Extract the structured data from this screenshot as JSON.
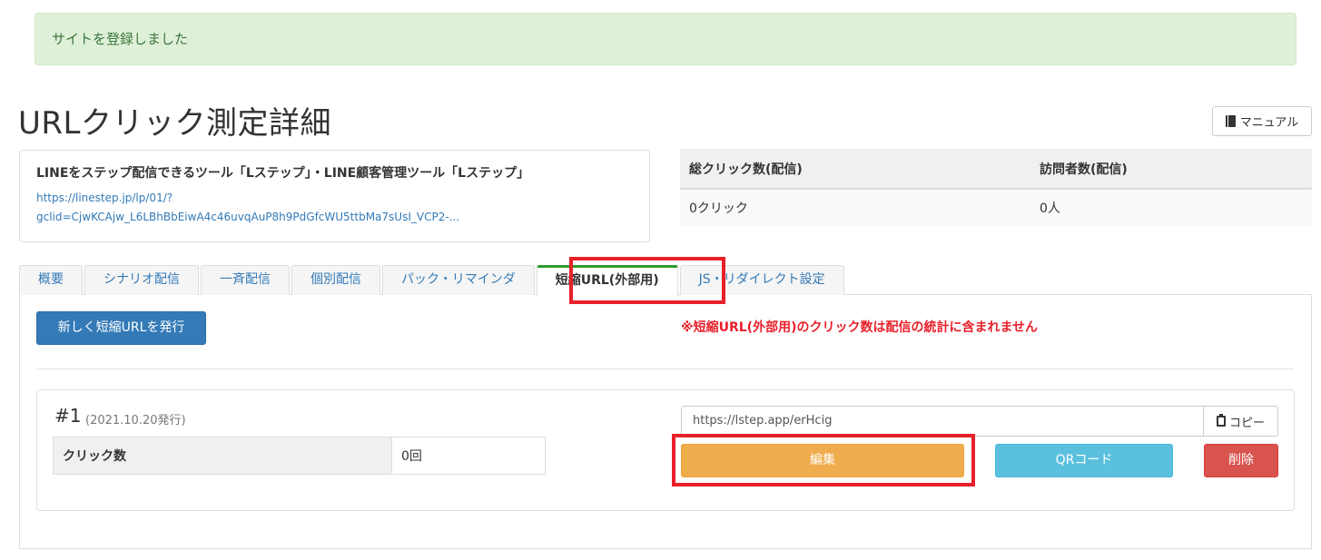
{
  "alert": {
    "message": "サイトを登録しました"
  },
  "header": {
    "title": "URLクリック測定詳細",
    "manual_label": "マニュアル"
  },
  "site": {
    "name": "LINEをステップ配信できるツール「Lステップ」・LINE顧客管理ツール「Lステップ」",
    "url_line1": "https://linestep.jp/lp/01/?",
    "url_line2": "gclid=CjwKCAjw_L6LBhBbEiwA4c46uvqAuP8h9PdGfcWU5ttbMa7sUsI_VCP2-..."
  },
  "stats": {
    "headers": [
      "総クリック数(配信)",
      "訪問者数(配信)"
    ],
    "values": [
      "0クリック",
      "0人"
    ]
  },
  "tabs": [
    {
      "label": "概要"
    },
    {
      "label": "シナリオ配信"
    },
    {
      "label": "一斉配信"
    },
    {
      "label": "個別配信"
    },
    {
      "label": "パック・リマインダ"
    },
    {
      "label": "短縮URL(外部用)"
    },
    {
      "label": "JS・リダイレクト設定"
    }
  ],
  "short_url": {
    "issue_label": "新しく短縮URLを発行",
    "warning": "※短縮URL(外部用)のクリック数は配信の統計に含まれません",
    "item": {
      "number": "#1",
      "date": "(2021.10.20発行)",
      "click_label": "クリック数",
      "click_value": "0回",
      "url": "https://lstep.app/erHcig",
      "copy_label": "コピー",
      "edit_label": "編集",
      "qr_label": "QRコード",
      "delete_label": "削除"
    }
  },
  "icons": {
    "manual": "book-icon",
    "copy": "clipboard-icon"
  },
  "colors": {
    "highlight": "#e8202a",
    "primary": "#337ab7",
    "warning": "#f0ad4e",
    "info": "#5bc0de",
    "danger": "#d9534f",
    "success_bg": "#dff0d8"
  }
}
